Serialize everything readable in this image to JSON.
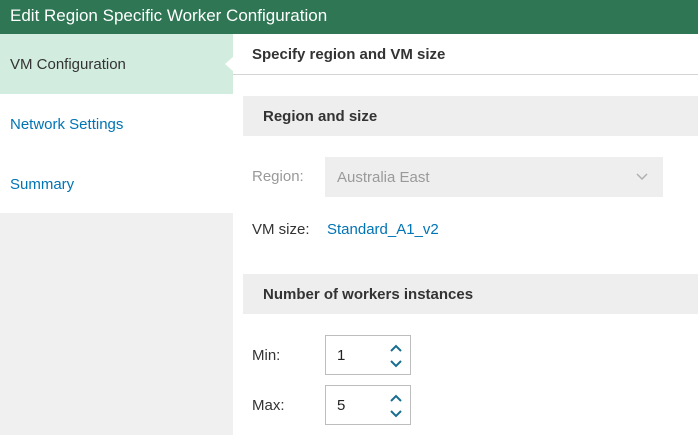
{
  "window": {
    "title": "Edit Region Specific Worker Configuration"
  },
  "sidebar": {
    "items": [
      {
        "label": "VM Configuration",
        "active": true
      },
      {
        "label": "Network Settings",
        "active": false
      },
      {
        "label": "Summary",
        "active": false
      }
    ]
  },
  "main": {
    "header": "Specify region and VM size",
    "region_section": {
      "title": "Region and size",
      "region_label": "Region:",
      "region_value": "Australia East",
      "vm_size_label": "VM size:",
      "vm_size_value": "Standard_A1_v2"
    },
    "workers_section": {
      "title": "Number of workers instances",
      "min_label": "Min:",
      "min_value": "1",
      "max_label": "Max:",
      "max_value": "5"
    }
  },
  "colors": {
    "titlebar": "#2e7654",
    "active_nav": "#d2ecdf",
    "link": "#0074b4"
  },
  "icons": [
    "chevron-down-icon",
    "chevron-up-icon"
  ]
}
